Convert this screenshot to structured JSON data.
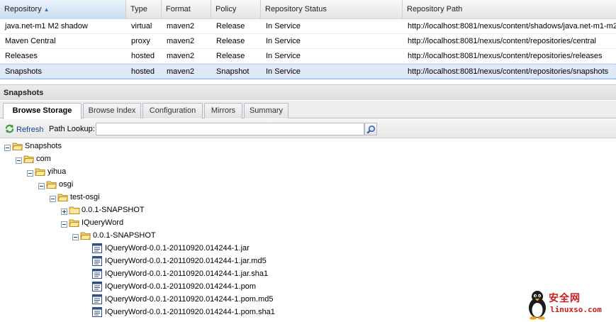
{
  "grid": {
    "columns": [
      "Repository",
      "Type",
      "Format",
      "Policy",
      "Repository Status",
      "Repository Path"
    ],
    "sorted_column": "Repository",
    "rows": [
      {
        "name": "java.net-m1 M2 shadow",
        "type": "virtual",
        "format": "maven2",
        "policy": "Release",
        "status": "In Service",
        "path": "http://localhost:8081/nexus/content/shadows/java.net-m1-m2"
      },
      {
        "name": "Maven Central",
        "type": "proxy",
        "format": "maven2",
        "policy": "Release",
        "status": "In Service",
        "path": "http://localhost:8081/nexus/content/repositories/central"
      },
      {
        "name": "Releases",
        "type": "hosted",
        "format": "maven2",
        "policy": "Release",
        "status": "In Service",
        "path": "http://localhost:8081/nexus/content/repositories/releases"
      },
      {
        "name": "Snapshots",
        "type": "hosted",
        "format": "maven2",
        "policy": "Snapshot",
        "status": "In Service",
        "path": "http://localhost:8081/nexus/content/repositories/snapshots",
        "selected": true
      }
    ]
  },
  "panel": {
    "title": "Snapshots"
  },
  "tabs": [
    {
      "label": "Browse Storage",
      "active": true
    },
    {
      "label": "Browse Index"
    },
    {
      "label": "Configuration"
    },
    {
      "label": "Mirrors"
    },
    {
      "label": "Summary"
    }
  ],
  "toolbar": {
    "refresh_label": "Refresh",
    "path_lookup_label": "Path Lookup:",
    "path_lookup_value": "",
    "refresh_icon": "refresh-icon",
    "search_icon": "search-icon"
  },
  "tree": [
    {
      "label": "Snapshots",
      "level": 0,
      "kind": "folder",
      "expanded": true
    },
    {
      "label": "com",
      "level": 1,
      "kind": "folder",
      "expanded": true
    },
    {
      "label": "yihua",
      "level": 2,
      "kind": "folder",
      "expanded": true
    },
    {
      "label": "osgi",
      "level": 3,
      "kind": "folder",
      "expanded": true
    },
    {
      "label": "test-osgi",
      "level": 4,
      "kind": "folder",
      "expanded": true
    },
    {
      "label": "0.0.1-SNAPSHOT",
      "level": 5,
      "kind": "folder",
      "expanded": false
    },
    {
      "label": "IQueryWord",
      "level": 5,
      "kind": "folder",
      "expanded": true
    },
    {
      "label": "0.0.1-SNAPSHOT",
      "level": 6,
      "kind": "folder",
      "expanded": true
    },
    {
      "label": "IQueryWord-0.0.1-20110920.014244-1.jar",
      "level": 7,
      "kind": "file"
    },
    {
      "label": "IQueryWord-0.0.1-20110920.014244-1.jar.md5",
      "level": 7,
      "kind": "file"
    },
    {
      "label": "IQueryWord-0.0.1-20110920.014244-1.jar.sha1",
      "level": 7,
      "kind": "file"
    },
    {
      "label": "IQueryWord-0.0.1-20110920.014244-1.pom",
      "level": 7,
      "kind": "file"
    },
    {
      "label": "IQueryWord-0.0.1-20110920.014244-1.pom.md5",
      "level": 7,
      "kind": "file"
    },
    {
      "label": "IQueryWord-0.0.1-20110920.014244-1.pom.sha1",
      "level": 7,
      "kind": "file"
    }
  ],
  "watermark": {
    "text_cn": "安全网",
    "text_en": "linuxso.com",
    "icon": "penguin-icon"
  },
  "colors": {
    "selected_row": "#dfe8f6",
    "folder_yellow": "#f6d46b",
    "toolbar_link": "#15428b",
    "watermark_red": "#c81e1e"
  }
}
